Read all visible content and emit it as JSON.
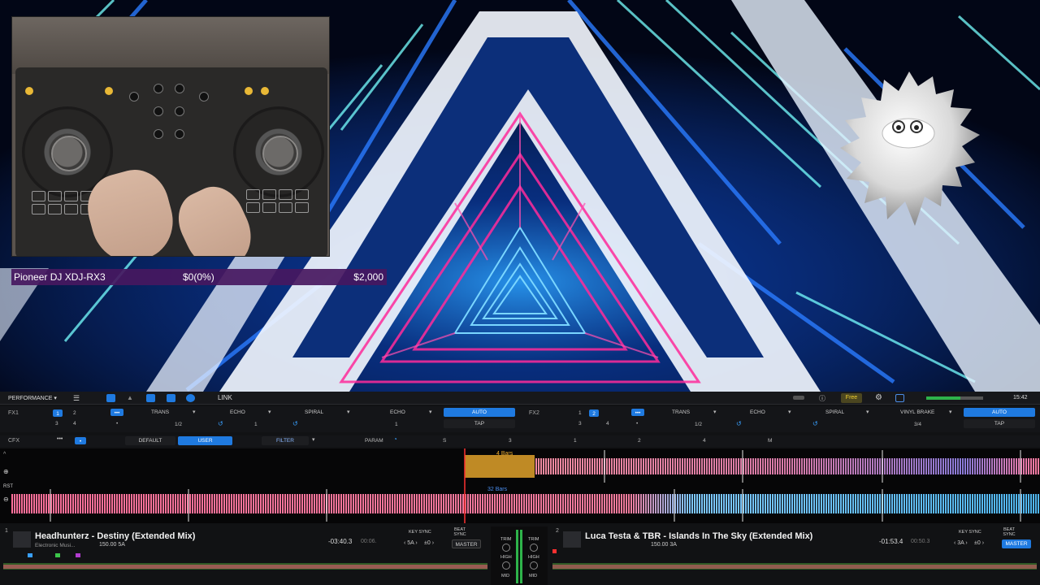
{
  "overlay": {
    "caption": {
      "product": "Pioneer DJ XDJ-RX3",
      "progress": "$0(0%)",
      "goal": "$2,000"
    }
  },
  "toolbar": {
    "mode": "PERFORMANCE",
    "link": "LINK",
    "free": "Free",
    "clock": "15:42"
  },
  "fx1": {
    "label": "FX1",
    "decks": [
      "1",
      "2",
      "3",
      "4"
    ],
    "slots": [
      "TRANS",
      "ECHO",
      "SPIRAL"
    ],
    "echo": "ECHO",
    "beat": "1/2",
    "beat_val": "1",
    "auto": "AUTO",
    "tap": "TAP"
  },
  "fx2": {
    "label": "FX2",
    "decks": [
      "1",
      "2",
      "3",
      "4"
    ],
    "slots": [
      "TRANS",
      "ECHO",
      "SPIRAL"
    ],
    "brake": "VINYL BRAKE",
    "beat": "1/2",
    "beat2": "3/4",
    "auto": "AUTO",
    "tap": "TAP"
  },
  "cfx": {
    "label": "CFX",
    "default": "DEFAULT",
    "user": "USER",
    "filter": "FILTER",
    "param": "PARAM",
    "markers": [
      "S",
      "3",
      "1",
      "2",
      "4",
      "M"
    ]
  },
  "waveform": {
    "bars_top": "4 Bars",
    "bars_bottom": "32 Bars",
    "rst": "RST"
  },
  "deck1": {
    "num": "1",
    "title": "Headhunterz - Destiny (Extended Mix)",
    "genre": "Electronic Musi...",
    "bpm_key": "150.00 5A",
    "time_remain": "-03:40.3",
    "time_elapsed": "00:06.",
    "key_sync": "KEY SYNC",
    "beat_sync": "BEAT SYNC",
    "key": "5A",
    "pm": "±0",
    "master": "MASTER"
  },
  "deck2": {
    "num": "2",
    "title": "Luca Testa & TBR - Islands In The Sky (Extended Mix)",
    "bpm_key": "150.00 3A",
    "time_remain": "-01:53.4",
    "time_elapsed": "00:50.3",
    "key_sync": "KEY SYNC",
    "beat_sync": "BEAT SYNC",
    "key": "3A",
    "pm": "±0",
    "master": "MASTER"
  },
  "mixer": {
    "trim": "TRIM",
    "high": "HIGH",
    "mid": "MID"
  }
}
